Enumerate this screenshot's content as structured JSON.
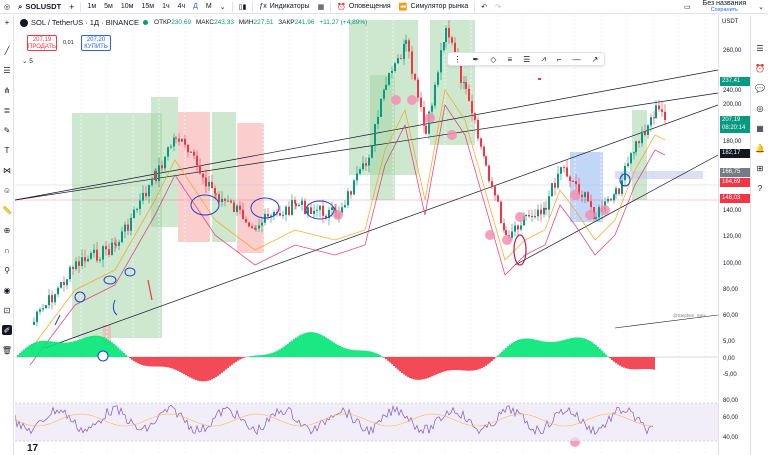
{
  "topbar": {
    "symbol": "SOLUSDT",
    "add_symbol": "+",
    "intervals": [
      "1м",
      "5м",
      "10м",
      "15м",
      "1ч",
      "4ч",
      "Д",
      "М"
    ],
    "chart_type_icon": "candles-icon",
    "indicators_label": "Индикаторы",
    "alerts_label": "Оповещения",
    "replay_label": "Симулятор рынка",
    "undo_icon": "undo-icon",
    "redo_icon": "redo-icon",
    "layout_name": "Без названия",
    "save_label": "Сохранить"
  },
  "legend": {
    "pair": "SOL / TetherUS · 1Д · BINANCE",
    "open_label": "ОТКР",
    "open_value": "230,69",
    "high_label": "МАКС",
    "high_value": "243,33",
    "low_label": "МИН",
    "low_value": "227,51",
    "close_label": "ЗАКР",
    "close_value": "241,96",
    "change": "+11,27 (+4,89%)",
    "sell_price": "207,19",
    "sell_label": "ПРОДАТЬ",
    "spread": "0,01",
    "buy_price": "207,20",
    "buy_label": "КУПИТЬ",
    "indicators_count": "5"
  },
  "axis": {
    "currency": "USDT",
    "ticks": [
      "260,00",
      "240,00",
      "200,00",
      "180,00",
      "140,00",
      "120,00",
      "100,00",
      "80,00",
      "60,00",
      "5,00",
      "0,00",
      "-5,00",
      "80,00",
      "60,00",
      "40,00"
    ],
    "labels": [
      {
        "text": "237,41",
        "color": "#089981"
      },
      {
        "text": "207,19",
        "color": "#089981"
      },
      {
        "text": "08:20:14",
        "color": "#089981"
      },
      {
        "text": "182,17",
        "color": "#131722"
      },
      {
        "text": "166,75",
        "color": "#787b86"
      },
      {
        "text": "164,69",
        "color": "#f23645"
      },
      {
        "text": "148,03",
        "color": "#f23645"
      }
    ]
  },
  "watermark": "@Stephen_Sarc",
  "colors": {
    "up": "#089981",
    "down": "#f23645",
    "accent": "#2962ff",
    "green_zone": "#a5d6a7",
    "red_zone": "#f8a5a5",
    "blue_zone": "#90b4f0",
    "rsi_line": "#7e57c2"
  }
}
